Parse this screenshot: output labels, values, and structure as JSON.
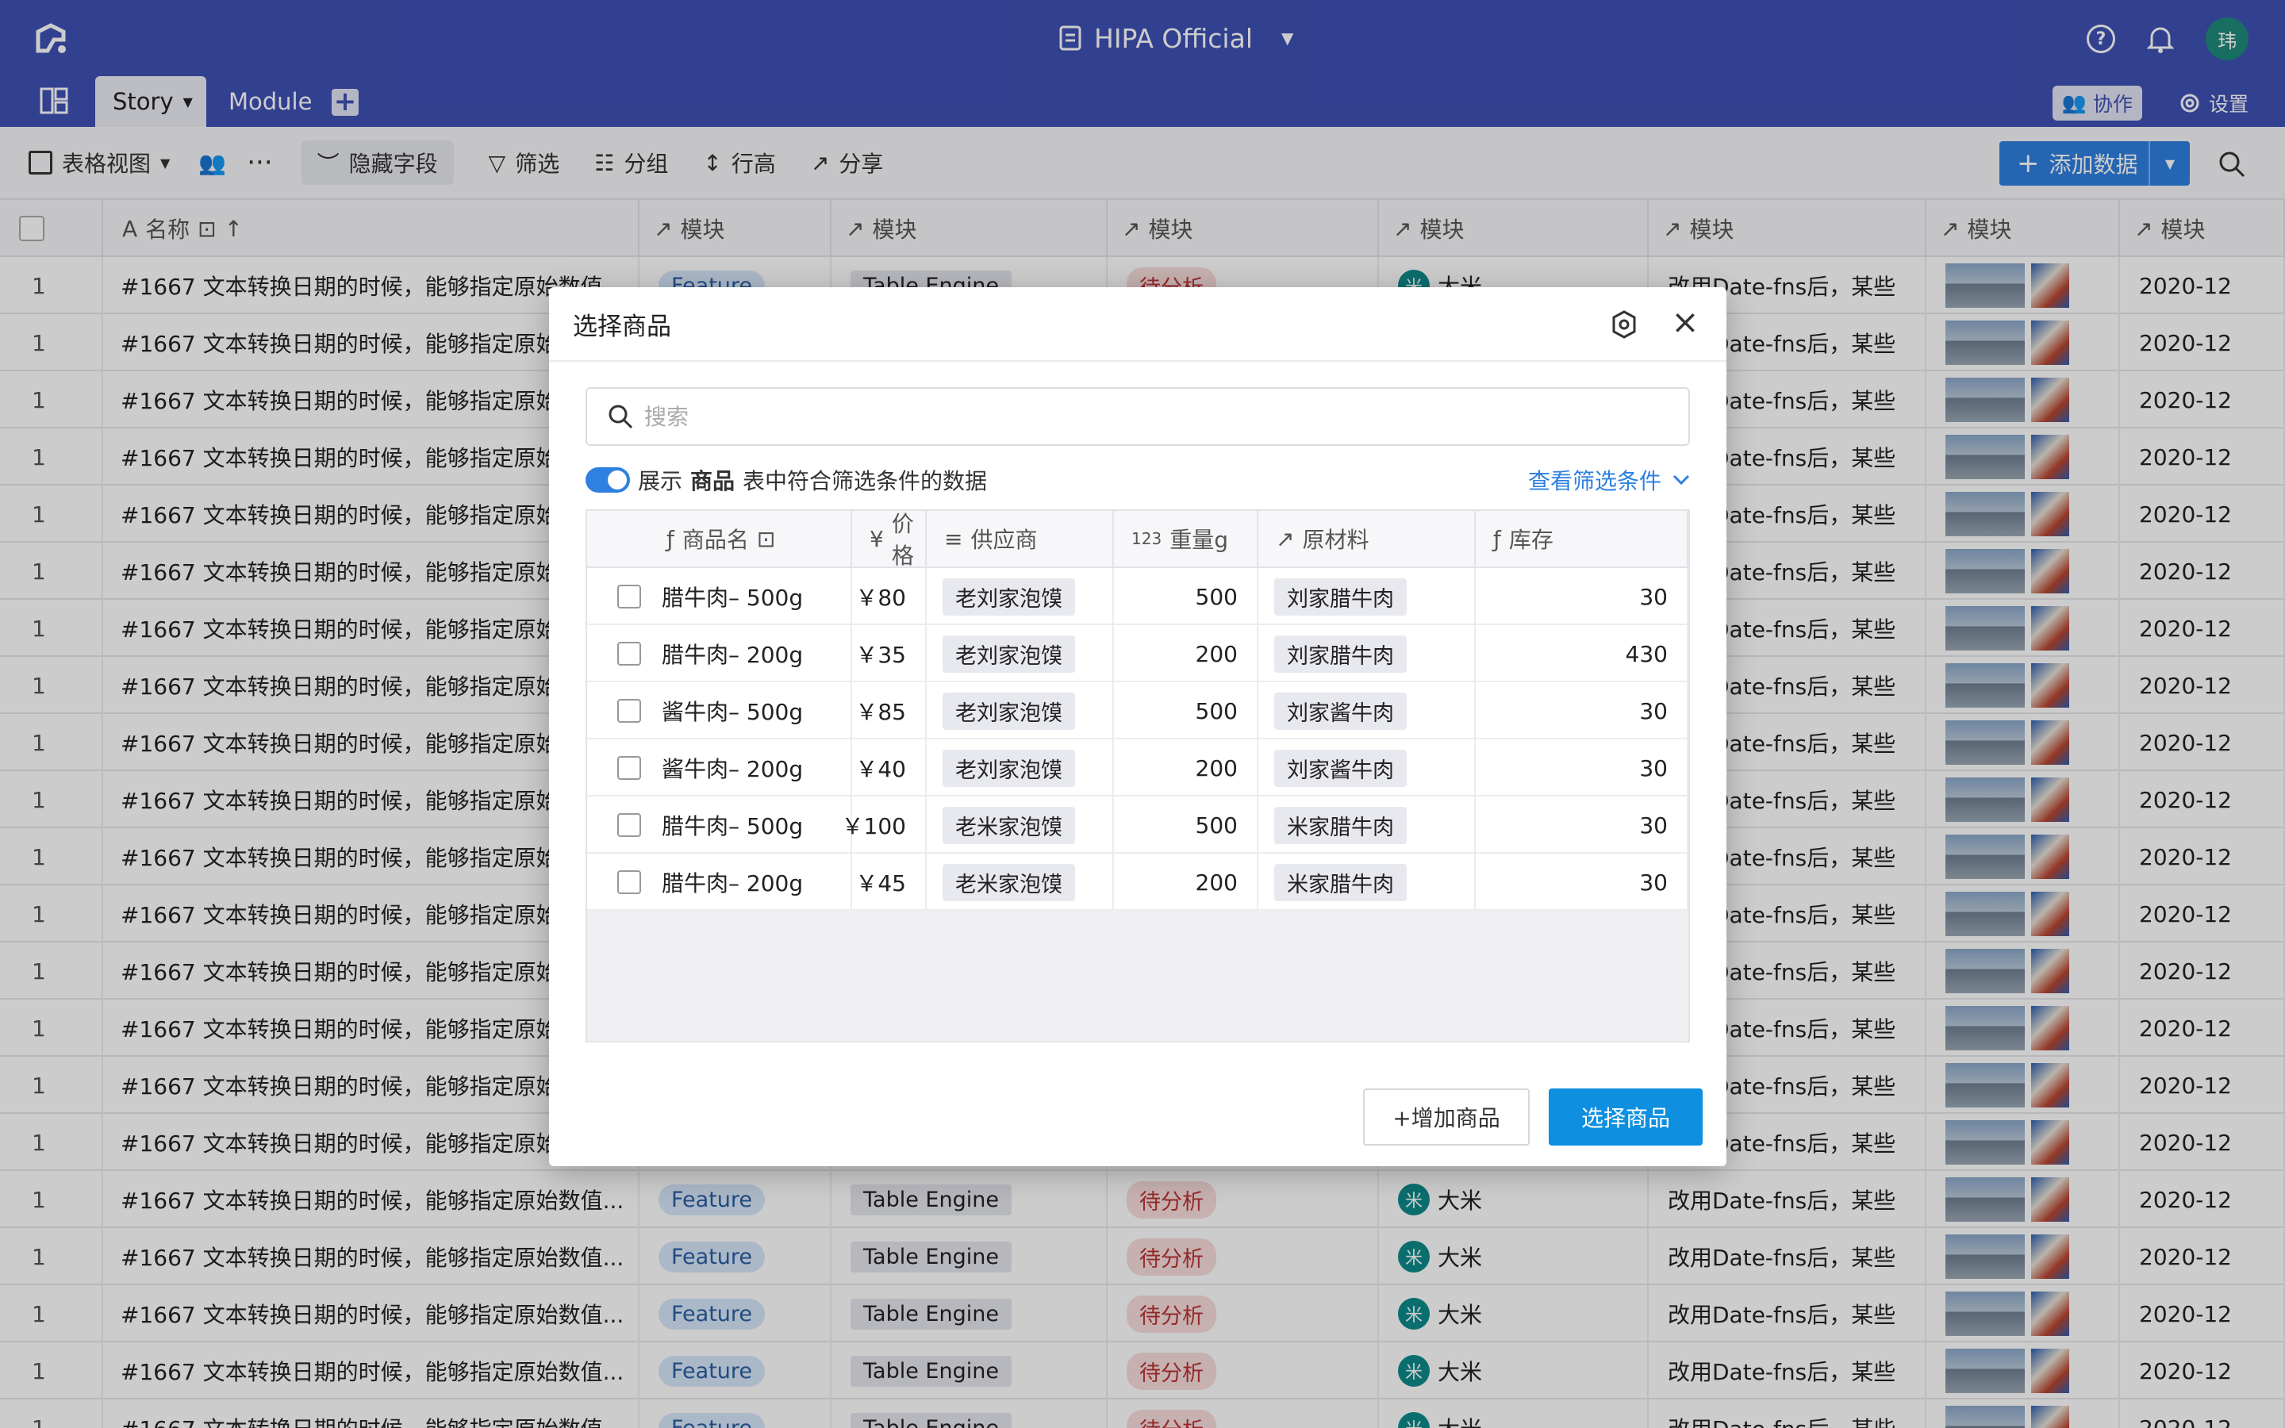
{
  "app": {
    "title": "HIPA Official",
    "avatar": "玮",
    "collab_label": "协作",
    "settings_label": "设置"
  },
  "tabs": [
    {
      "label": "Story"
    },
    {
      "label": "Module"
    }
  ],
  "toolbar": {
    "view_label": "表格视图",
    "hide_fields": "隐藏字段",
    "filter": "筛选",
    "group": "分组",
    "row_height": "行高",
    "share": "分享",
    "add_data": "添加数据"
  },
  "table": {
    "headers": [
      "名称",
      "模块",
      "模块",
      "模块",
      "模块",
      "模块",
      "模块",
      "模块"
    ],
    "row": {
      "num": "1",
      "name": "#1667 文本转换日期的时候，能够指定原始数值...",
      "feature": "Feature",
      "engine": "Table Engine",
      "status": "待分析",
      "person_initial": "米",
      "person": "大米",
      "desc": "改用Date-fns后，某些",
      "date": "2020-12"
    },
    "row_count": 21
  },
  "modal": {
    "title": "选择商品",
    "search_placeholder": "搜索",
    "filter_prefix": "展示",
    "filter_table": "商品",
    "filter_suffix": "表中符合筛选条件的数据",
    "view_conditions": "查看筛选条件",
    "columns": [
      "商品名",
      "价格",
      "供应商",
      "重量g",
      "原材料",
      "库存"
    ],
    "rows": [
      {
        "name": "腊牛肉– 500g",
        "price": "￥80",
        "supplier": "老刘家泡馍",
        "weight": "500",
        "material": "刘家腊牛肉",
        "stock": "30"
      },
      {
        "name": "腊牛肉– 200g",
        "price": "￥35",
        "supplier": "老刘家泡馍",
        "weight": "200",
        "material": "刘家腊牛肉",
        "stock": "430"
      },
      {
        "name": "酱牛肉– 500g",
        "price": "￥85",
        "supplier": "老刘家泡馍",
        "weight": "500",
        "material": "刘家酱牛肉",
        "stock": "30"
      },
      {
        "name": "酱牛肉– 200g",
        "price": "￥40",
        "supplier": "老刘家泡馍",
        "weight": "200",
        "material": "刘家酱牛肉",
        "stock": "30"
      },
      {
        "name": "腊牛肉– 500g",
        "price": "￥100",
        "supplier": "老米家泡馍",
        "weight": "500",
        "material": "米家腊牛肉",
        "stock": "30"
      },
      {
        "name": "腊牛肉– 200g",
        "price": "￥45",
        "supplier": "老米家泡馍",
        "weight": "200",
        "material": "米家腊牛肉",
        "stock": "30"
      }
    ],
    "add_button": "+增加商品",
    "select_button": "选择商品"
  },
  "colors": {
    "header_bg": "#3f50b5",
    "primary": "#0e8fe0",
    "link": "#2f80e0"
  }
}
